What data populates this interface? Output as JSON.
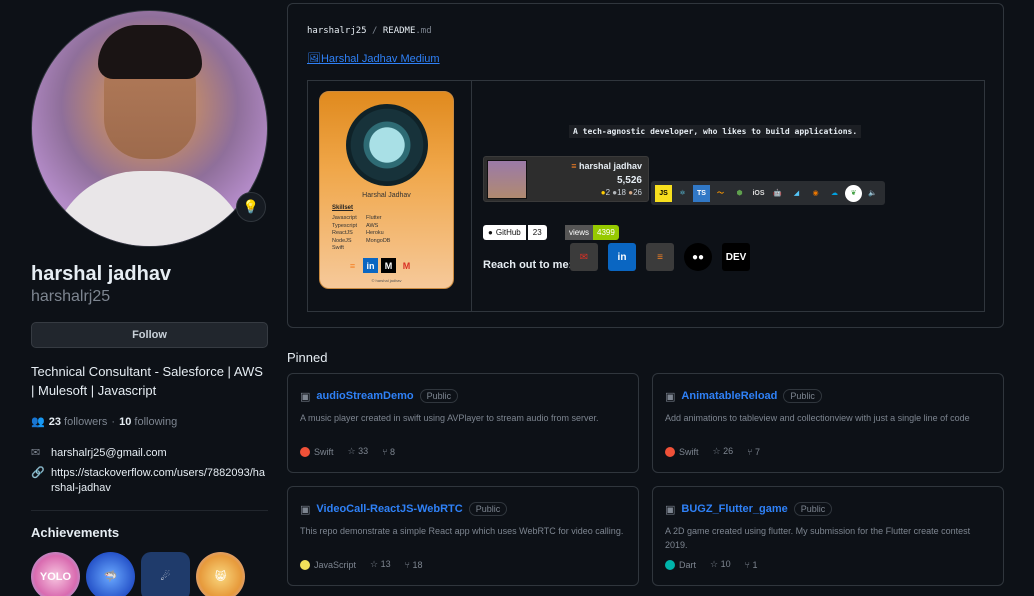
{
  "profile": {
    "name": "harshal jadhav",
    "login": "harshalrj25",
    "follow_label": "Follow",
    "bio": "Technical Consultant - Salesforce | AWS | Mulesoft | Javascript",
    "followers_count": "23",
    "followers_label": "followers",
    "separator": "·",
    "following_count": "10",
    "following_label": "following",
    "email": "harshalrj25@gmail.com",
    "website": "https://stackoverflow.com/users/7882093/harshal-jadhav",
    "achievements_title": "Achievements",
    "badges": [
      "YOLO",
      "Pull Shark",
      "Starstruck",
      "Pair Extraordinaire"
    ]
  },
  "readme": {
    "owner": "harshalrj25",
    "slash": "/",
    "file": "README",
    "ext": ".md",
    "medium_link": "Harshal Jadhav Medium",
    "card": {
      "name": "Harshal Jadhav",
      "skillset_label": "Skillset",
      "skills": [
        "Javascript",
        "Flutter",
        "Typescript",
        "AWS",
        "ReactJS",
        "Heroku",
        "NodeJS",
        "MongoDB",
        "Swift",
        ""
      ],
      "footer": "© harshal jadhav"
    },
    "tagline": "A tech-agnostic developer, who likes to build applications.",
    "stack": {
      "username": "harshal jadhav",
      "reputation": "5,526",
      "gold": "2",
      "silver": "18",
      "bronze": "26"
    },
    "tech_icons": [
      "JS",
      "React",
      "TS",
      "AWS",
      "Node",
      "iOS",
      "Android",
      "Flutter",
      "Blender",
      "Salesforce",
      "MongoDB",
      "Audio"
    ],
    "github_label": "GitHub",
    "github_count": "23",
    "views_label": "views",
    "views_count": "4399",
    "reach_label": "Reach out to me:",
    "social": [
      "Gmail",
      "LinkedIn",
      "StackOverflow",
      "Medium",
      "DEV"
    ]
  },
  "pinned": {
    "title": "Pinned",
    "repos": [
      {
        "name": "audioStreamDemo",
        "visibility": "Public",
        "desc": "A music player created in swift using AVPlayer to stream audio from server.",
        "lang": "Swift",
        "lang_color": "#f05138",
        "stars": "33",
        "forks": "8"
      },
      {
        "name": "AnimatableReload",
        "visibility": "Public",
        "desc": "Add animations to tableview and collectionview with just a single line of code",
        "lang": "Swift",
        "lang_color": "#f05138",
        "stars": "26",
        "forks": "7"
      },
      {
        "name": "VideoCall-ReactJS-WebRTC",
        "visibility": "Public",
        "desc": "This repo demonstrate a simple React app which uses WebRTC for video calling.",
        "lang": "JavaScript",
        "lang_color": "#f1e05a",
        "stars": "13",
        "forks": "18"
      },
      {
        "name": "BUGZ_Flutter_game",
        "visibility": "Public",
        "desc": "A 2D game created using flutter. My submission for the Flutter create contest 2019.",
        "lang": "Dart",
        "lang_color": "#00b4ab",
        "stars": "10",
        "forks": "1"
      }
    ]
  }
}
